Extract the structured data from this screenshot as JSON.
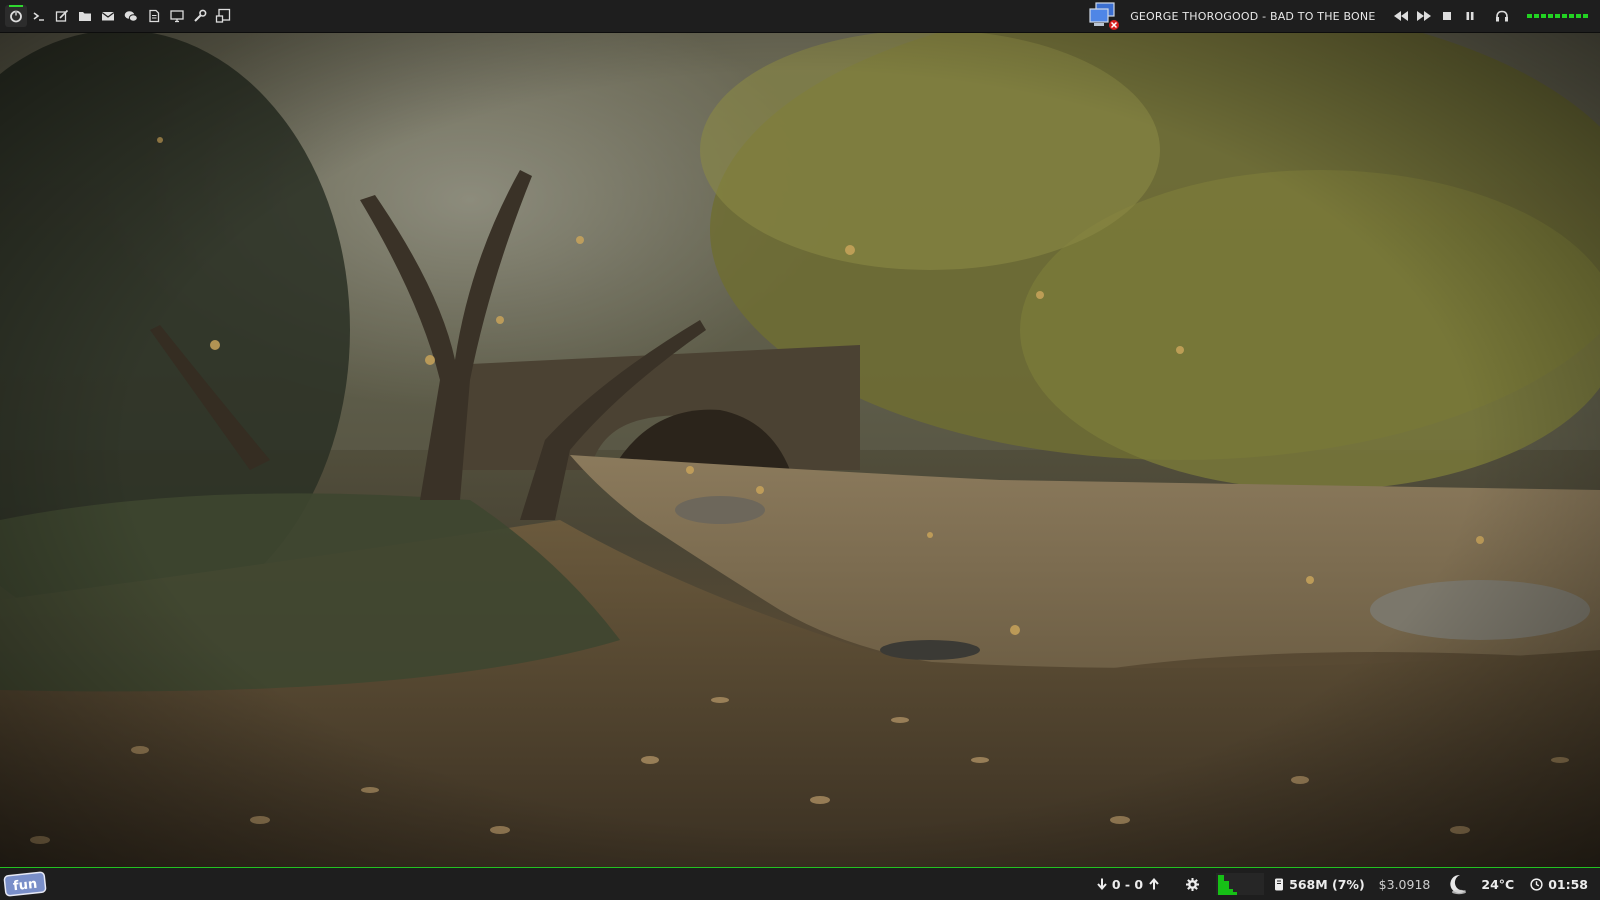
{
  "topbar": {
    "launchers": [
      {
        "name": "system-menu-icon"
      },
      {
        "name": "terminal-icon"
      },
      {
        "name": "editor-icon"
      },
      {
        "name": "files-icon"
      },
      {
        "name": "mail-icon"
      },
      {
        "name": "chat-icon"
      },
      {
        "name": "document-icon"
      },
      {
        "name": "display-icon"
      },
      {
        "name": "settings-tools-icon"
      },
      {
        "name": "screenshot-icon"
      }
    ],
    "now_playing": "GEORGE THOROGOOD - BAD TO THE BONE",
    "media_controls": [
      "rewind-icon",
      "fast-forward-icon",
      "stop-icon",
      "pause-icon",
      "headphones-icon"
    ],
    "volume_level": 1.0,
    "accent_color": "#22d322"
  },
  "bottombar": {
    "logo_text": "fun",
    "net_traffic": "0 - 0",
    "memory": "568M (7%)",
    "ticker": "$3.0918",
    "temperature": "24°C",
    "clock": "01:58",
    "accent_color": "#22c222"
  }
}
